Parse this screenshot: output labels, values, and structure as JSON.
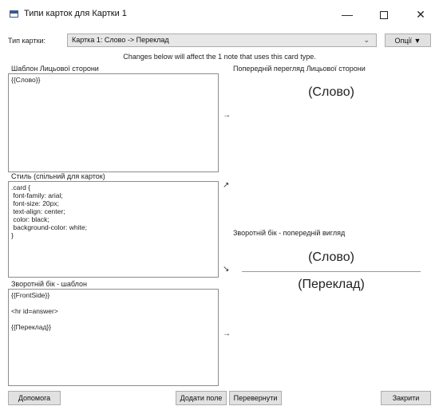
{
  "window": {
    "title": "Типи карток для Картки 1",
    "minimize_glyph": "—",
    "close_glyph": "✕"
  },
  "toolbar": {
    "card_type_label": "Тип картки:",
    "card_type_value": "Картка 1: Слово -> Переклад",
    "options_label": "Опції ▼"
  },
  "notice": "Changes below will affect the 1 note that uses this card type.",
  "front_template": {
    "label": "Шаблон Лицьової сторони",
    "content": "{{Слово}}"
  },
  "styling": {
    "label": "Стиль (спільний для карток)",
    "content": ".card {\n font-family: arial;\n font-size: 20px;\n text-align: center;\n color: black;\n background-color: white;\n}"
  },
  "back_template": {
    "label": "Зворотній бік - шаблон",
    "content": "{{FrontSide}}\n\n<hr id=answer>\n\n{{Переклад}}"
  },
  "front_preview": {
    "label": "Попередній перегляд Лицьової сторони",
    "text": "(Слово)"
  },
  "back_preview": {
    "label": "Зворотній бік - попередній вигляд",
    "question": "(Слово)",
    "answer": "(Переклад)"
  },
  "arrows": {
    "front": "→",
    "style_up": "↗",
    "style_down": "↘",
    "back": "→"
  },
  "buttons": {
    "help": "Допомога",
    "add_field": "Додати поле",
    "flip": "Перевернути",
    "close": "Закрити"
  }
}
